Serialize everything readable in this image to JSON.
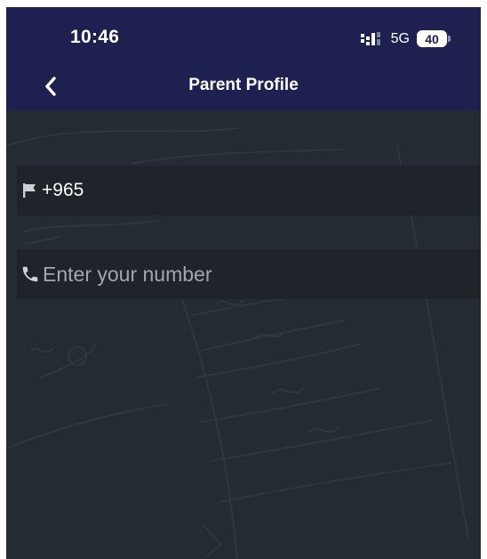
{
  "status_bar": {
    "time": "10:46",
    "network": "5G",
    "battery": "40"
  },
  "nav": {
    "title": "Parent Profile",
    "back_icon": "chevron-left-icon"
  },
  "form": {
    "country_code": {
      "icon": "flag-icon",
      "value": "+965"
    },
    "phone": {
      "icon": "phone-icon",
      "value": "",
      "placeholder": "Enter your number"
    }
  },
  "colors": {
    "header_bg": "#1e2150",
    "screen_bg": "#252b33",
    "field_bg": "#1f242b",
    "text": "#ffffff",
    "placeholder": "#a3a6ab"
  }
}
